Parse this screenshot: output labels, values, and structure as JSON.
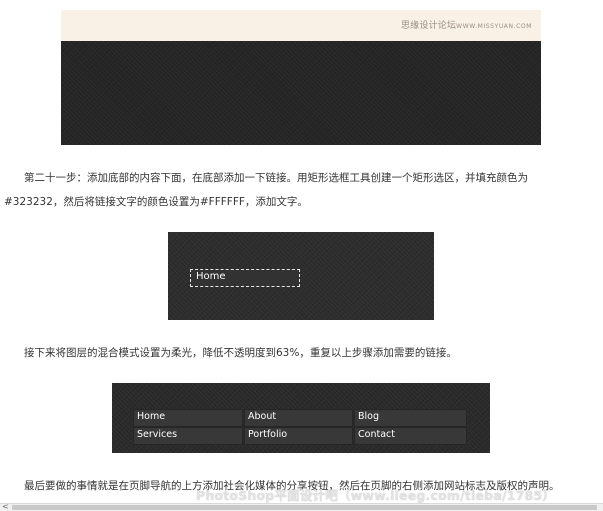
{
  "figure1": {
    "site_label_cn": "思缘设计论坛",
    "site_label_url": "WWW.MISSYUAN.COM"
  },
  "step21": {
    "line1": "第二十一步：添加底部的内容下面，在底部添加一下链接。用矩形选框工具创建一个矩形选区，并填充颜色为",
    "line2": "#323232，然后将链接文字的颜色设置为#FFFFFF，添加文字。"
  },
  "figure2": {
    "link_text": "Home"
  },
  "blend_paragraph": "接下来将图层的混合模式设置为柔光，降低不透明度到63%，重复以上步骤添加需要的链接。",
  "figure3": {
    "links": [
      [
        "Home",
        "About",
        "Blog"
      ],
      [
        "Services",
        "Portfolio",
        "Contact"
      ]
    ]
  },
  "final_paragraph": "最后要做的事情就是在页脚导航的上方添加社会化媒体的分享按钮，然后在页脚的右侧添加网站标志及版权的声明。",
  "watermark": "PhotoShop平面设计吧（www.lieeg.com/tieba/1785）",
  "scrollbar": {
    "left_arrow": "<"
  }
}
